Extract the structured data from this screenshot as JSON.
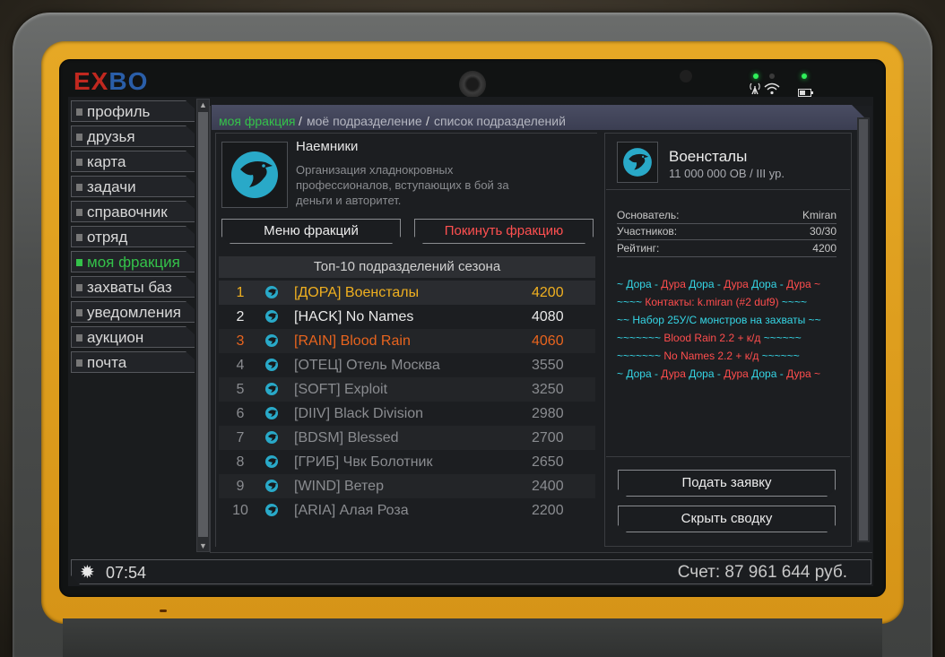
{
  "logo": {
    "part1": "EX",
    "part2": "BO"
  },
  "sidebar": {
    "items": [
      {
        "label": "профиль"
      },
      {
        "label": "друзья"
      },
      {
        "label": "карта"
      },
      {
        "label": "задачи"
      },
      {
        "label": "справочник"
      },
      {
        "label": "отряд"
      },
      {
        "label": "моя фракция",
        "active": true
      },
      {
        "label": "захваты баз"
      },
      {
        "label": "уведомления"
      },
      {
        "label": "аукцион"
      },
      {
        "label": "почта"
      }
    ]
  },
  "breadcrumb": {
    "items": [
      "моя фракция",
      "моё подразделение",
      "список подразделений"
    ],
    "separator": "/"
  },
  "faction": {
    "name": "Наемники",
    "description": "Организация хладнокровных профессионалов, вступающих в бой за деньги и авторитет.",
    "menu_button": "Меню фракций",
    "leave_button": "Покинуть фракцию"
  },
  "top10": {
    "title": "Топ-10 подразделений сезона",
    "rows": [
      {
        "rank": "1",
        "name": "[ДОРА] Военсталы",
        "score": "4200",
        "color": "#f0b020"
      },
      {
        "rank": "2",
        "name": "[HACK] No Names",
        "score": "4080",
        "color": "#e8e8e8"
      },
      {
        "rank": "3",
        "name": "[RAIN] Blood Rain",
        "score": "4060",
        "color": "#e8641e"
      },
      {
        "rank": "4",
        "name": "[ОТЕЦ] Отель Москва",
        "score": "3550",
        "color": "#8a8c90"
      },
      {
        "rank": "5",
        "name": "[SOFT] Exploit",
        "score": "3250",
        "color": "#8a8c90"
      },
      {
        "rank": "6",
        "name": "[DIIV] Black Division",
        "score": "2980",
        "color": "#8a8c90"
      },
      {
        "rank": "7",
        "name": "[BDSM] Blessed",
        "score": "2700",
        "color": "#8a8c90"
      },
      {
        "rank": "8",
        "name": "[ГРИБ] Чвк Болотник",
        "score": "2650",
        "color": "#8a8c90"
      },
      {
        "rank": "9",
        "name": "[WIND] Ветер",
        "score": "2400",
        "color": "#8a8c90"
      },
      {
        "rank": "10",
        "name": "[ARIA] Алая Роза",
        "score": "2200",
        "color": "#8a8c90"
      }
    ]
  },
  "subdivision": {
    "name": "Военсталы",
    "subtitle": "11 000 000 ОВ / III ур.",
    "stats": [
      {
        "key": "Основатель:",
        "value": "Kmiran"
      },
      {
        "key": "Участников:",
        "value": "30/30"
      },
      {
        "key": "Рейтинг:",
        "value": "4200"
      }
    ],
    "motd": [
      [
        {
          "t": "~ Дора - ",
          "c": "cyan"
        },
        {
          "t": "Дура ",
          "c": "red"
        },
        {
          "t": "Дора - ",
          "c": "cyan"
        },
        {
          "t": "Дура ",
          "c": "red"
        },
        {
          "t": "Дора - ",
          "c": "cyan"
        },
        {
          "t": "Дура ~",
          "c": "red"
        }
      ],
      [
        {
          "t": "~~~~ ",
          "c": "cyan"
        },
        {
          "t": "Контакты: k.miran (#2 duf9) ",
          "c": "red"
        },
        {
          "t": "~~~~",
          "c": "cyan"
        }
      ],
      [
        {
          "t": "~~ Набор 25У/С монстров на захваты ~~",
          "c": "cyan"
        }
      ],
      [
        {
          "t": "~~~~~~~ ",
          "c": "cyan"
        },
        {
          "t": "Blood Rain 2.2 + к/д ",
          "c": "red"
        },
        {
          "t": "~~~~~~",
          "c": "cyan"
        }
      ],
      [
        {
          "t": "~~~~~~~ ",
          "c": "cyan"
        },
        {
          "t": "No Names 2.2 + к/д ",
          "c": "red"
        },
        {
          "t": "~~~~~~",
          "c": "cyan"
        }
      ],
      [
        {
          "t": "~ Дора - ",
          "c": "cyan"
        },
        {
          "t": "Дура ",
          "c": "red"
        },
        {
          "t": "Дора - ",
          "c": "cyan"
        },
        {
          "t": "Дура ",
          "c": "red"
        },
        {
          "t": "Дора - ",
          "c": "cyan"
        },
        {
          "t": "Дура ~",
          "c": "red"
        }
      ]
    ],
    "apply_button": "Подать заявку",
    "hide_button": "Скрыть сводку"
  },
  "footer": {
    "time": "07:54",
    "balance": "Счет: 87 961 644 руб."
  },
  "colors": {
    "accent_green": "#34c24a",
    "cyan": "#35d6e6",
    "red": "#ff4d4d",
    "leave_button": "#ff5050",
    "tablet_frame": "#e6a825"
  }
}
